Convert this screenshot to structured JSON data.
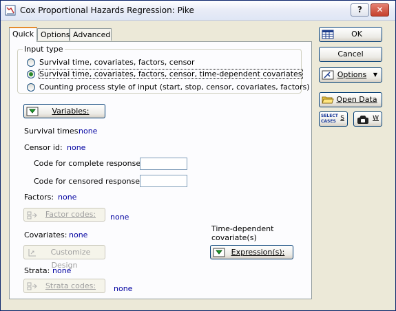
{
  "window": {
    "title": "Cox Proportional Hazards Regression: Pike",
    "help_label": "?",
    "close_label": "✕"
  },
  "tabs": [
    {
      "label": "Quick"
    },
    {
      "label": "Options"
    },
    {
      "label": "Advanced"
    }
  ],
  "input_type": {
    "label": "Input type",
    "options": [
      {
        "label": "Survival time, covariates, factors, censor",
        "selected": false
      },
      {
        "label": "Survival time, covariates, factors, censor, time-dependent covariates",
        "selected": true
      },
      {
        "label": "Counting process style of input (start, stop, censor, covariates, factors)",
        "selected": false
      }
    ]
  },
  "variables_button": "Variables:",
  "survival_times": {
    "label": "Survival times:",
    "value": "none"
  },
  "censor_id": {
    "label": "Censor id:",
    "value": "none"
  },
  "code_complete": {
    "label": "Code for complete responses:",
    "value": ""
  },
  "code_censored": {
    "label": "Code for censored responses:",
    "value": ""
  },
  "factors": {
    "label": "Factors:",
    "value": "none",
    "codes_button": "Factor codes:",
    "codes_value": "none"
  },
  "covariates": {
    "label": "Covariates:",
    "value": "none",
    "customize_button": "Customize Design"
  },
  "time_dependent": {
    "label": "Time-dependent covariate(s)",
    "button": "Expression(s):"
  },
  "strata": {
    "label": "Strata:",
    "value": "none",
    "codes_button": "Strata codes:",
    "codes_value": "none"
  },
  "side": {
    "ok": "OK",
    "cancel": "Cancel",
    "options": "Options",
    "open_data": "Open Data",
    "select_cases_top": "SELECT",
    "select_cases_bottom": "CASES",
    "s_label": "S",
    "w_label": "W"
  }
}
